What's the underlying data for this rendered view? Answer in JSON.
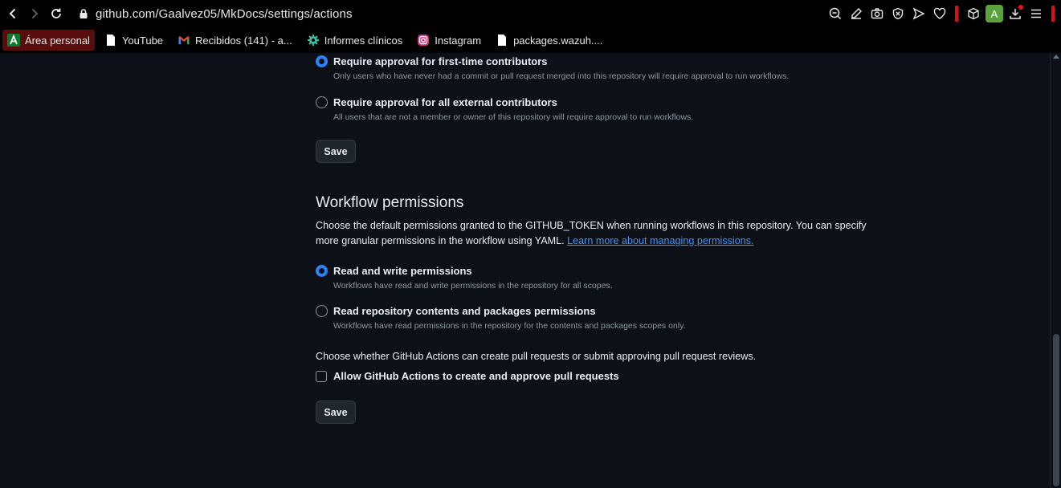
{
  "browser": {
    "url": "github.com/Gaalvez05/MkDocs/settings/actions",
    "avatar_letter": "A",
    "bookmarks": [
      {
        "label": "Área personal"
      },
      {
        "label": "YouTube"
      },
      {
        "label": "Recibidos (141) - a..."
      },
      {
        "label": "Informes clínicos"
      },
      {
        "label": "Instagram"
      },
      {
        "label": "packages.wazuh...."
      }
    ]
  },
  "approval": {
    "options": [
      {
        "label": "Require approval for first-time contributors",
        "desc": "Only users who have never had a commit or pull request merged into this repository will require approval to run workflows.",
        "checked": true
      },
      {
        "label": "Require approval for all external contributors",
        "desc": "All users that are not a member or owner of this repository will require approval to run workflows.",
        "checked": false
      }
    ],
    "save_label": "Save"
  },
  "workflow": {
    "heading": "Workflow permissions",
    "intro": "Choose the default permissions granted to the GITHUB_TOKEN when running workflows in this repository. You can specify more granular permissions in the workflow using YAML.",
    "link": "Learn more about managing permissions.",
    "options": [
      {
        "label": "Read and write permissions",
        "desc": "Workflows have read and write permissions in the repository for all scopes.",
        "checked": true
      },
      {
        "label": "Read repository contents and packages permissions",
        "desc": "Workflows have read permissions in the repository for the contents and packages scopes only.",
        "checked": false
      }
    ],
    "pr_prompt": "Choose whether GitHub Actions can create pull requests or submit approving pull request reviews.",
    "pr_checkbox": "Allow GitHub Actions to create and approve pull requests",
    "pr_checked": false,
    "save_label": "Save"
  },
  "colors": {
    "accent": "#2f81f7",
    "link": "#4493f8",
    "background": "#0d1117"
  }
}
